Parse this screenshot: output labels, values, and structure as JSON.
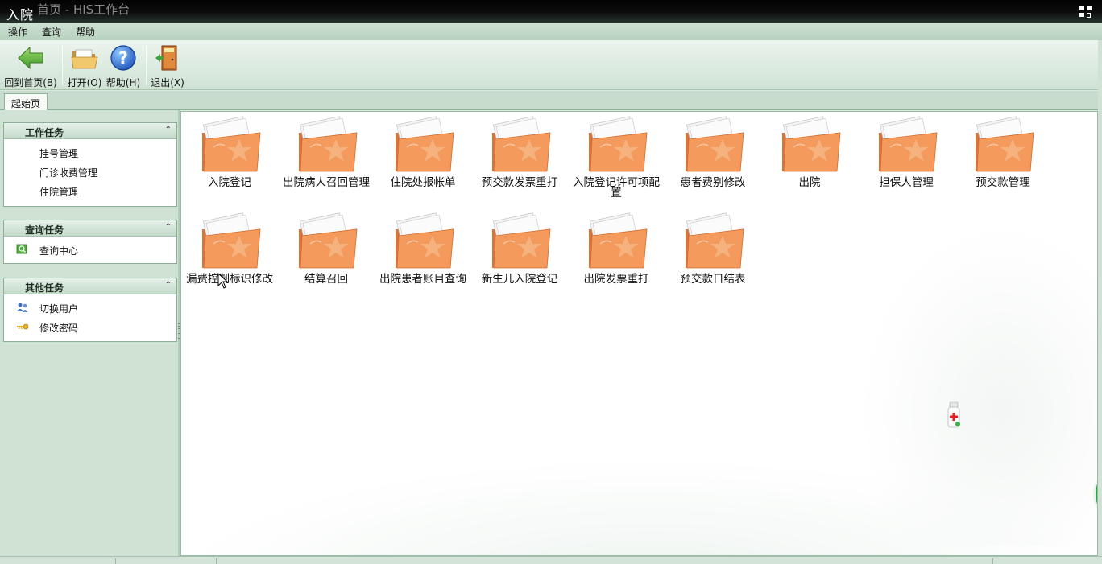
{
  "window": {
    "title": "入院",
    "ghost_title": "首页 - HIS工作台"
  },
  "menu": {
    "items": [
      "操作",
      "查询",
      "帮助"
    ]
  },
  "toolbar": {
    "home_label": "回到首页(B)",
    "open_label": "打开(O)",
    "help_label": "帮助(H)",
    "exit_label": "退出(X)"
  },
  "tabs": {
    "active": "起始页"
  },
  "sidebar": {
    "groups": [
      {
        "title": "工作任务",
        "items": [
          "挂号管理",
          "门诊收费管理",
          "住院管理"
        ]
      },
      {
        "title": "查询任务",
        "items": [
          "查询中心"
        ]
      },
      {
        "title": "其他任务",
        "items": [
          "切换用户",
          "修改密码"
        ]
      }
    ]
  },
  "shortcuts": [
    "入院登记",
    "出院病人召回管理",
    "住院处报帐单",
    "预交款发票重打",
    "入院登记许可项配置",
    "患者费别修改",
    "出院",
    "担保人管理",
    "预交款管理",
    "漏费控制标识修改",
    "结算召回",
    "出院患者账目查询",
    "新生儿入院登记",
    "出院发票重打",
    "预交款日结表"
  ],
  "colors": {
    "folder_orange": "#f39a5c",
    "frame_green": "#cfe2d4",
    "titlebar": "#0a0a0a"
  }
}
